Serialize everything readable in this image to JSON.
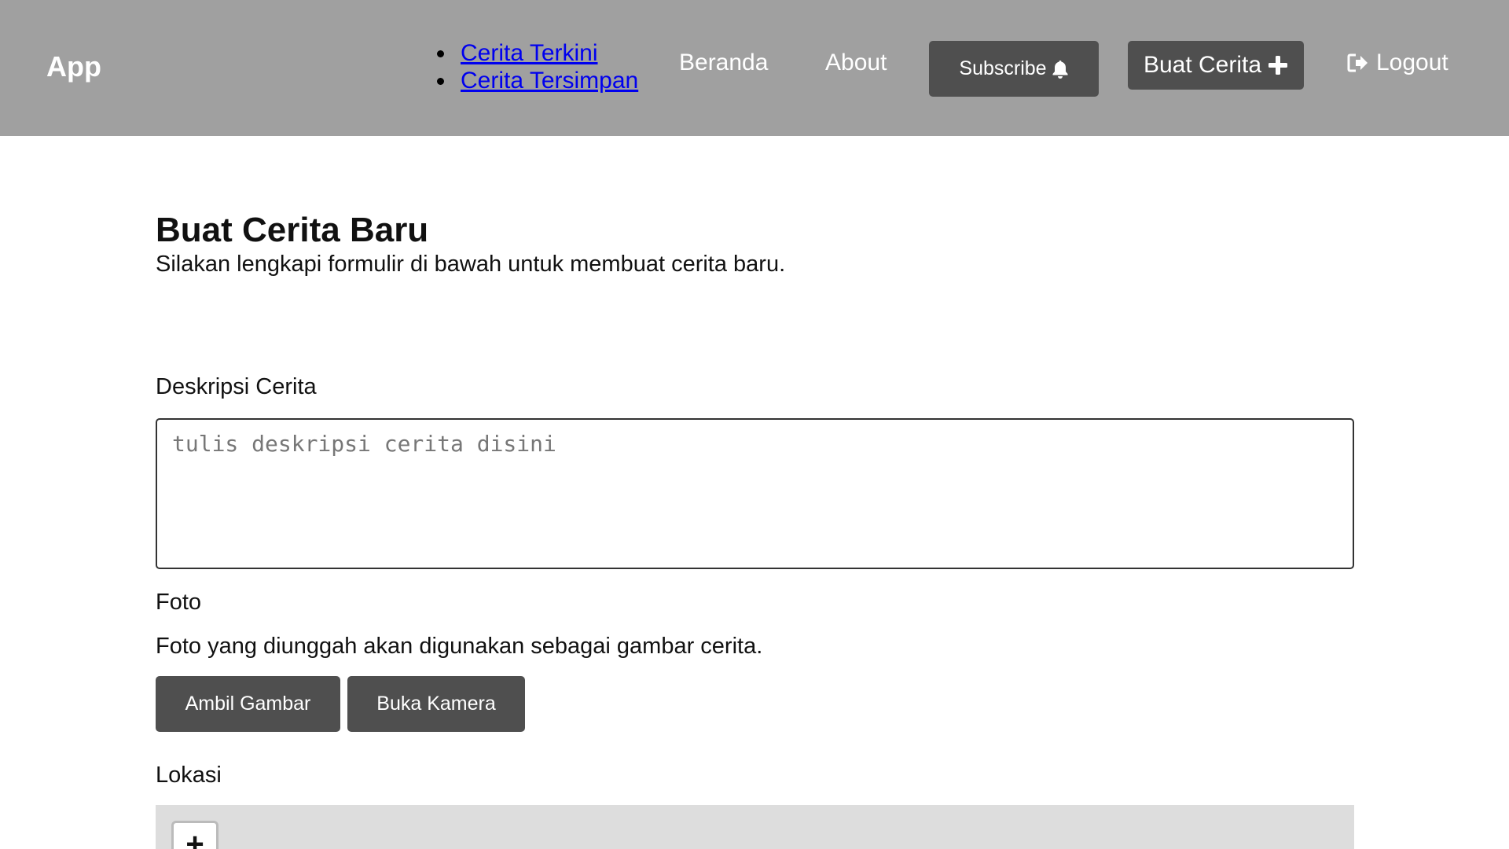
{
  "header": {
    "brand": "App",
    "dropdown_links": [
      "Cerita Terkini",
      "Cerita Tersimpan"
    ],
    "nav_beranda": "Beranda",
    "nav_about": "About",
    "subscribe_label": "Subscribe",
    "subscribe_icon": "bell-icon",
    "buat_cerita_label": "Buat Cerita",
    "buat_cerita_icon": "plus-icon",
    "logout_label": "Logout",
    "logout_icon": "sign-out-icon"
  },
  "main": {
    "title": "Buat Cerita Baru",
    "subtitle": "Silakan lengkapi formulir di bawah untuk membuat cerita baru.",
    "description": {
      "label": "Deskripsi Cerita",
      "placeholder": "tulis deskripsi cerita disini",
      "value": ""
    },
    "photo": {
      "label": "Foto",
      "help": "Foto yang diunggah akan digunakan sebagai gambar cerita.",
      "take_picture_label": "Ambil Gambar",
      "open_camera_label": "Buka Kamera"
    },
    "location": {
      "label": "Lokasi",
      "zoom_in_label": "+"
    }
  },
  "colors": {
    "header_bg": "#a0a0a0",
    "button_bg": "#4f4f4f",
    "map_bg": "#dddddd",
    "link": "#0000ee"
  }
}
